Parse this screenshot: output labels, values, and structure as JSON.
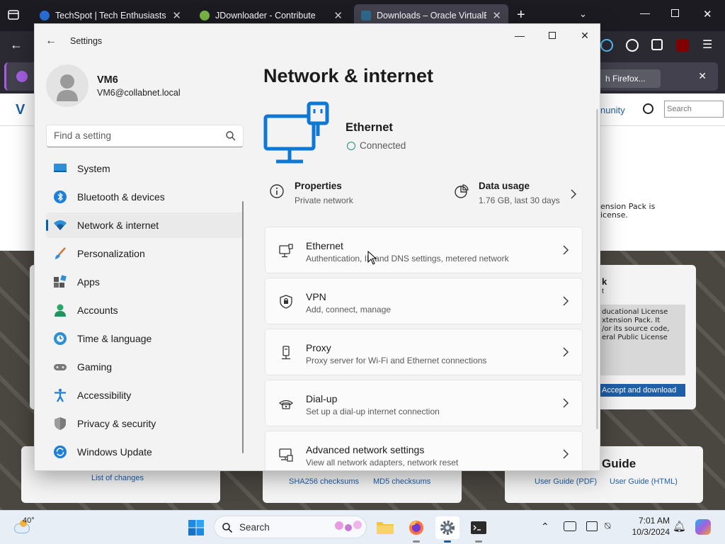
{
  "browser": {
    "tabs": [
      {
        "title": "TechSpot | Tech Enthusiasts, Po",
        "icon": "techspot-icon",
        "active": false
      },
      {
        "title": "JDownloader - Contribute",
        "icon": "jdownloader-icon",
        "active": false
      },
      {
        "title": "Downloads – Oracle VirtualBox",
        "icon": "virtualbox-icon",
        "active": true
      }
    ],
    "notification_button": "h Firefox..."
  },
  "background_page": {
    "nav_link": "nunity",
    "search_placeholder": "Search",
    "extension_text_1": "ension Pack is",
    "extension_text_2": "icense.",
    "card_heading": "k",
    "card_sub": "t",
    "license_lines": [
      "ducational License",
      "xtension Pack. It",
      "/or its source code,",
      "eral Public License"
    ],
    "accept_button": "Accept and download",
    "guide_heading": "Guide",
    "list_of_changes": "List of changes",
    "sha256": "SHA256 checksums",
    "md5": "MD5 checksums",
    "user_guide_pdf": "User Guide (PDF)",
    "user_guide_html": "User Guide (HTML)"
  },
  "settings": {
    "app_title": "Settings",
    "user": {
      "name": "VM6",
      "email": "VM6@collabnet.local"
    },
    "search_placeholder": "Find a setting",
    "nav": [
      {
        "label": "System",
        "icon": "system-icon"
      },
      {
        "label": "Bluetooth & devices",
        "icon": "bluetooth-icon"
      },
      {
        "label": "Network & internet",
        "icon": "wifi-icon",
        "selected": true
      },
      {
        "label": "Personalization",
        "icon": "brush-icon"
      },
      {
        "label": "Apps",
        "icon": "apps-icon"
      },
      {
        "label": "Accounts",
        "icon": "accounts-icon"
      },
      {
        "label": "Time & language",
        "icon": "clock-globe-icon"
      },
      {
        "label": "Gaming",
        "icon": "gamepad-icon"
      },
      {
        "label": "Accessibility",
        "icon": "accessibility-icon"
      },
      {
        "label": "Privacy & security",
        "icon": "shield-icon"
      },
      {
        "label": "Windows Update",
        "icon": "update-icon"
      }
    ],
    "page_title": "Network & internet",
    "connection": {
      "name": "Ethernet",
      "status": "Connected"
    },
    "properties": {
      "title": "Properties",
      "subtitle": "Private network"
    },
    "data_usage": {
      "title": "Data usage",
      "subtitle": "1.76 GB, last 30 days"
    },
    "cards": [
      {
        "title": "Ethernet",
        "subtitle": "Authentication, IP and DNS settings, metered network",
        "icon": "ethernet-icon"
      },
      {
        "title": "VPN",
        "subtitle": "Add, connect, manage",
        "icon": "vpn-shield-icon"
      },
      {
        "title": "Proxy",
        "subtitle": "Proxy server for Wi-Fi and Ethernet connections",
        "icon": "proxy-icon"
      },
      {
        "title": "Dial-up",
        "subtitle": "Set up a dial-up internet connection",
        "icon": "dialup-icon"
      },
      {
        "title": "Advanced network settings",
        "subtitle": "View all network adapters, network reset",
        "icon": "advanced-network-icon"
      }
    ]
  },
  "taskbar": {
    "weather": "40°",
    "search_label": "Search",
    "time": "7:01 AM",
    "date": "10/3/2024"
  },
  "colors": {
    "accent": "#005fb8",
    "ethernet_blue": "#0f78d4"
  }
}
